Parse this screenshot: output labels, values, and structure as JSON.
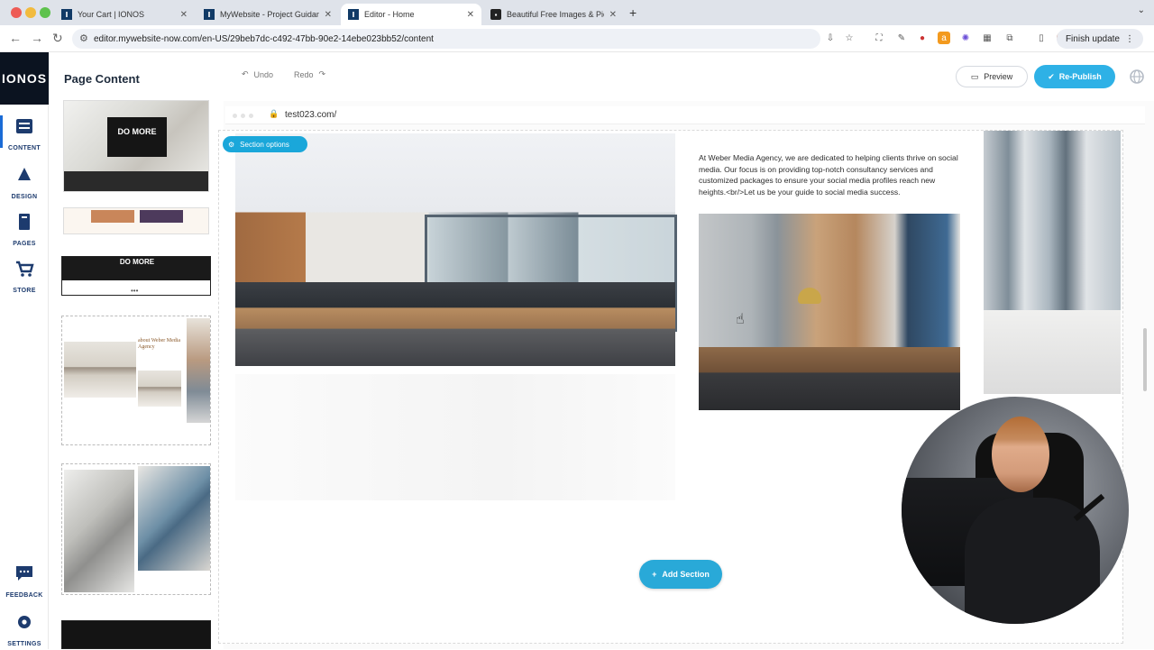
{
  "browser": {
    "tabs": [
      {
        "title": "Your Cart | IONOS",
        "favicon": "ionos-icon",
        "active": false
      },
      {
        "title": "MyWebsite - Project Guidance",
        "favicon": "ionos-icon",
        "active": false
      },
      {
        "title": "Editor - Home",
        "favicon": "ionos-icon",
        "active": true
      },
      {
        "title": "Beautiful Free Images & Pictures",
        "favicon": "unsplash-icon",
        "active": false
      }
    ],
    "url": "editor.mywebsite-now.com/en-US/29beb7dc-c492-47bb-90e2-14ebe023bb52/content",
    "finish_update": "Finish update"
  },
  "rail": {
    "logo": "IONOS",
    "items": [
      {
        "label": "CONTENT",
        "icon": "content-icon"
      },
      {
        "label": "DESIGN",
        "icon": "design-icon"
      },
      {
        "label": "PAGES",
        "icon": "pages-icon"
      },
      {
        "label": "STORE",
        "icon": "store-icon"
      },
      {
        "label": "FEEDBACK",
        "icon": "feedback-icon"
      },
      {
        "label": "SETTINGS",
        "icon": "settings-icon"
      }
    ]
  },
  "panel": {
    "title": "Page Content",
    "thumbnails": [
      {
        "caption": "DO MORE"
      },
      {
        "caption": ""
      },
      {
        "caption": "DO MORE"
      },
      {
        "caption": "about Weber Media Agency"
      },
      {
        "caption": ""
      },
      {
        "caption": ""
      }
    ]
  },
  "toolbar": {
    "undo": "Undo",
    "redo": "Redo",
    "preview": "Preview",
    "republish": "Re-Publish"
  },
  "canvas": {
    "site_url": "test023.com/",
    "section_options": "Section options",
    "paragraph": "At Weber Media Agency, we are dedicated to helping clients thrive on social media. Our focus is on providing top-notch consultancy services and customized packages to ensure your social media profiles reach new heights.<br/>Let us be your guide to social media success.",
    "add_section": "Add Section"
  },
  "colors": {
    "accent": "#2eb1e6",
    "rail_text": "#1d3b6e",
    "logo_bg": "#0b1320"
  }
}
